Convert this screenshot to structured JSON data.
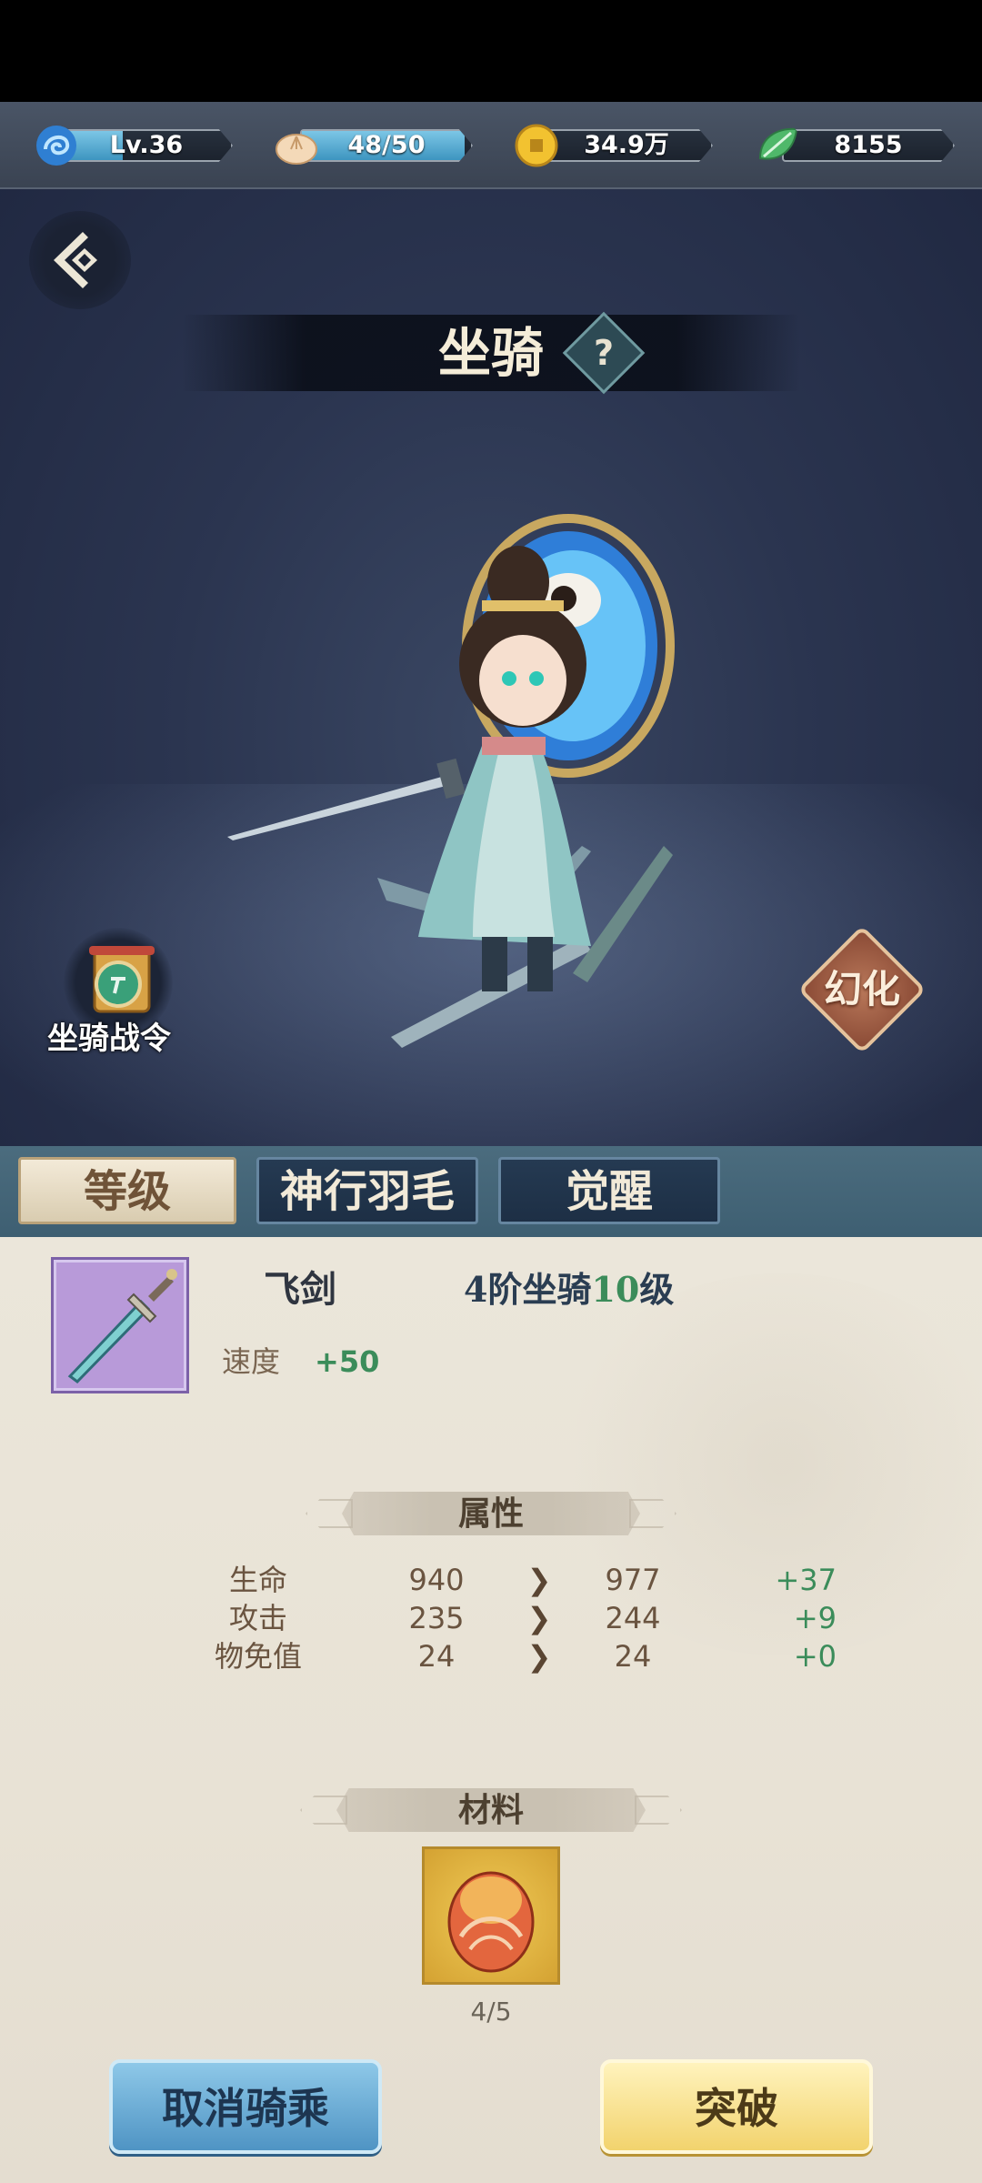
{
  "resources": [
    {
      "name": "level",
      "icon": "dragon-icon",
      "value": "Lv.36",
      "fill": 0.36
    },
    {
      "name": "stamina",
      "icon": "steamed-bun-icon",
      "value": "48/50",
      "fill": 0.96
    },
    {
      "name": "gold",
      "icon": "gold-coin-icon",
      "value": "34.9万",
      "fill": 0
    },
    {
      "name": "jade",
      "icon": "jade-leaf-icon",
      "value": "8155",
      "fill": 0
    }
  ],
  "header": {
    "title": "坐骑",
    "help_label": "?"
  },
  "side": {
    "mount_pass_label": "坐骑战令",
    "morph_label": "幻化"
  },
  "tabs": [
    {
      "label": "等级",
      "active": true
    },
    {
      "label": "神行羽毛",
      "active": false
    },
    {
      "label": "觉醒",
      "active": false
    }
  ],
  "mount": {
    "name": "飞剑",
    "rank_prefix": "4阶坐骑",
    "rank_level": "10",
    "rank_suffix": "级",
    "speed_label": "速度",
    "speed_value": "+50"
  },
  "attributes": {
    "header": "属性",
    "rows": [
      {
        "name": "生命",
        "current": "940",
        "next": "977",
        "delta": "+37"
      },
      {
        "name": "攻击",
        "current": "235",
        "next": "244",
        "delta": "+9"
      },
      {
        "name": "物免值",
        "current": "24",
        "next": "24",
        "delta": "+0"
      }
    ]
  },
  "materials": {
    "header": "材料",
    "count": "4/5"
  },
  "buttons": {
    "cancel_ride": "取消骑乘",
    "breakthrough": "突破"
  },
  "colors": {
    "accent_green": "#3b8c5a",
    "panel_bg": "#e8e2d5",
    "tab_bar": "#4b6c7e"
  }
}
